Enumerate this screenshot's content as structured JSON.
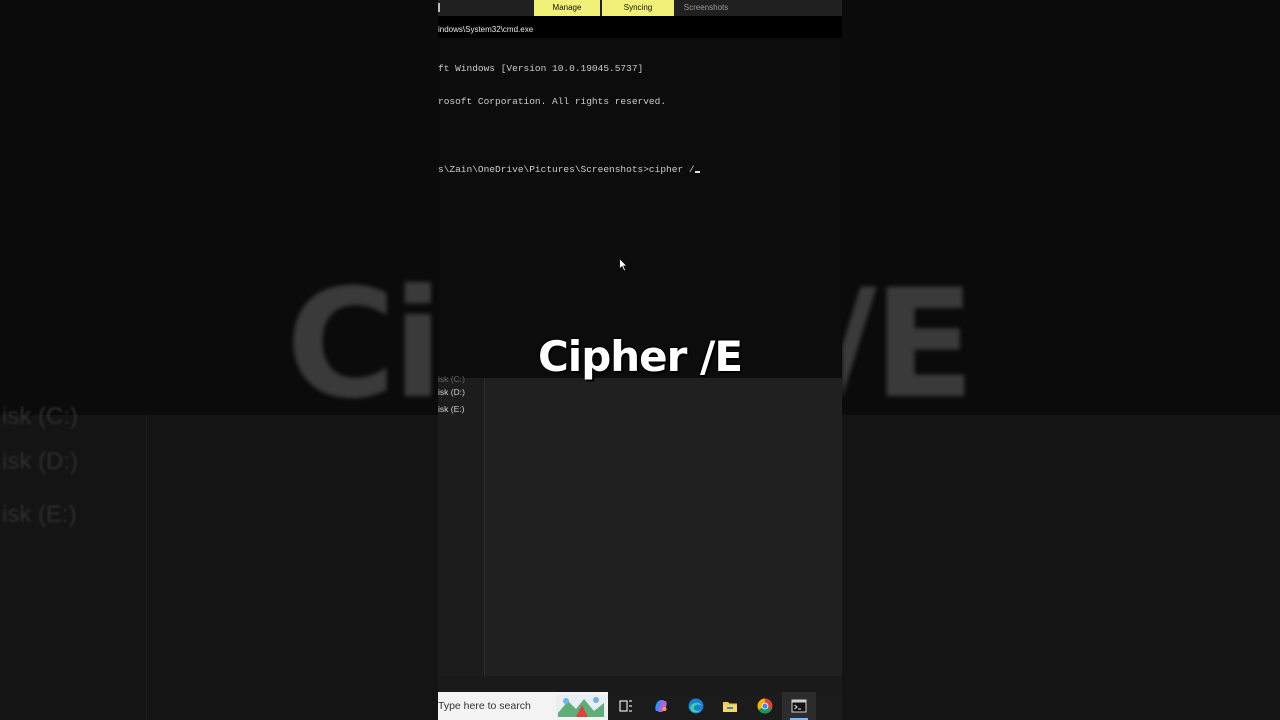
{
  "ribbon": {
    "tabs": [
      {
        "label": "Manage"
      },
      {
        "label": "Syncing"
      },
      {
        "label": "Screenshots"
      }
    ]
  },
  "cmd_window": {
    "title": "indows\\System32\\cmd.exe",
    "lines": [
      "ft Windows [Version 10.0.19045.5737]",
      "rosoft Corporation. All rights reserved.",
      "",
      "s\\Zain\\OneDrive\\Pictures\\Screenshots>cipher /"
    ]
  },
  "caption": "Cipher /E",
  "background_caption": {
    "left": "Ci",
    "right": "/E"
  },
  "explorer": {
    "drives": [
      {
        "label": "isk (C:)"
      },
      {
        "label": "isk (D:)"
      },
      {
        "label": "isk (E:)"
      }
    ]
  },
  "background_drives": [
    {
      "label": "isk (C:)"
    },
    {
      "label": "isk (D:)"
    },
    {
      "label": "isk (E:)"
    }
  ],
  "taskbar": {
    "search_placeholder": "Type here to search",
    "icons": [
      "task-view-icon",
      "copilot-icon",
      "edge-icon",
      "file-explorer-icon",
      "chrome-icon",
      "terminal-icon"
    ]
  },
  "colors": {
    "ribbon_highlight": "#f1f17a",
    "console_bg": "#0c0c0c",
    "console_text": "#cccccc",
    "taskbar_accent": "#7ab7ff"
  }
}
